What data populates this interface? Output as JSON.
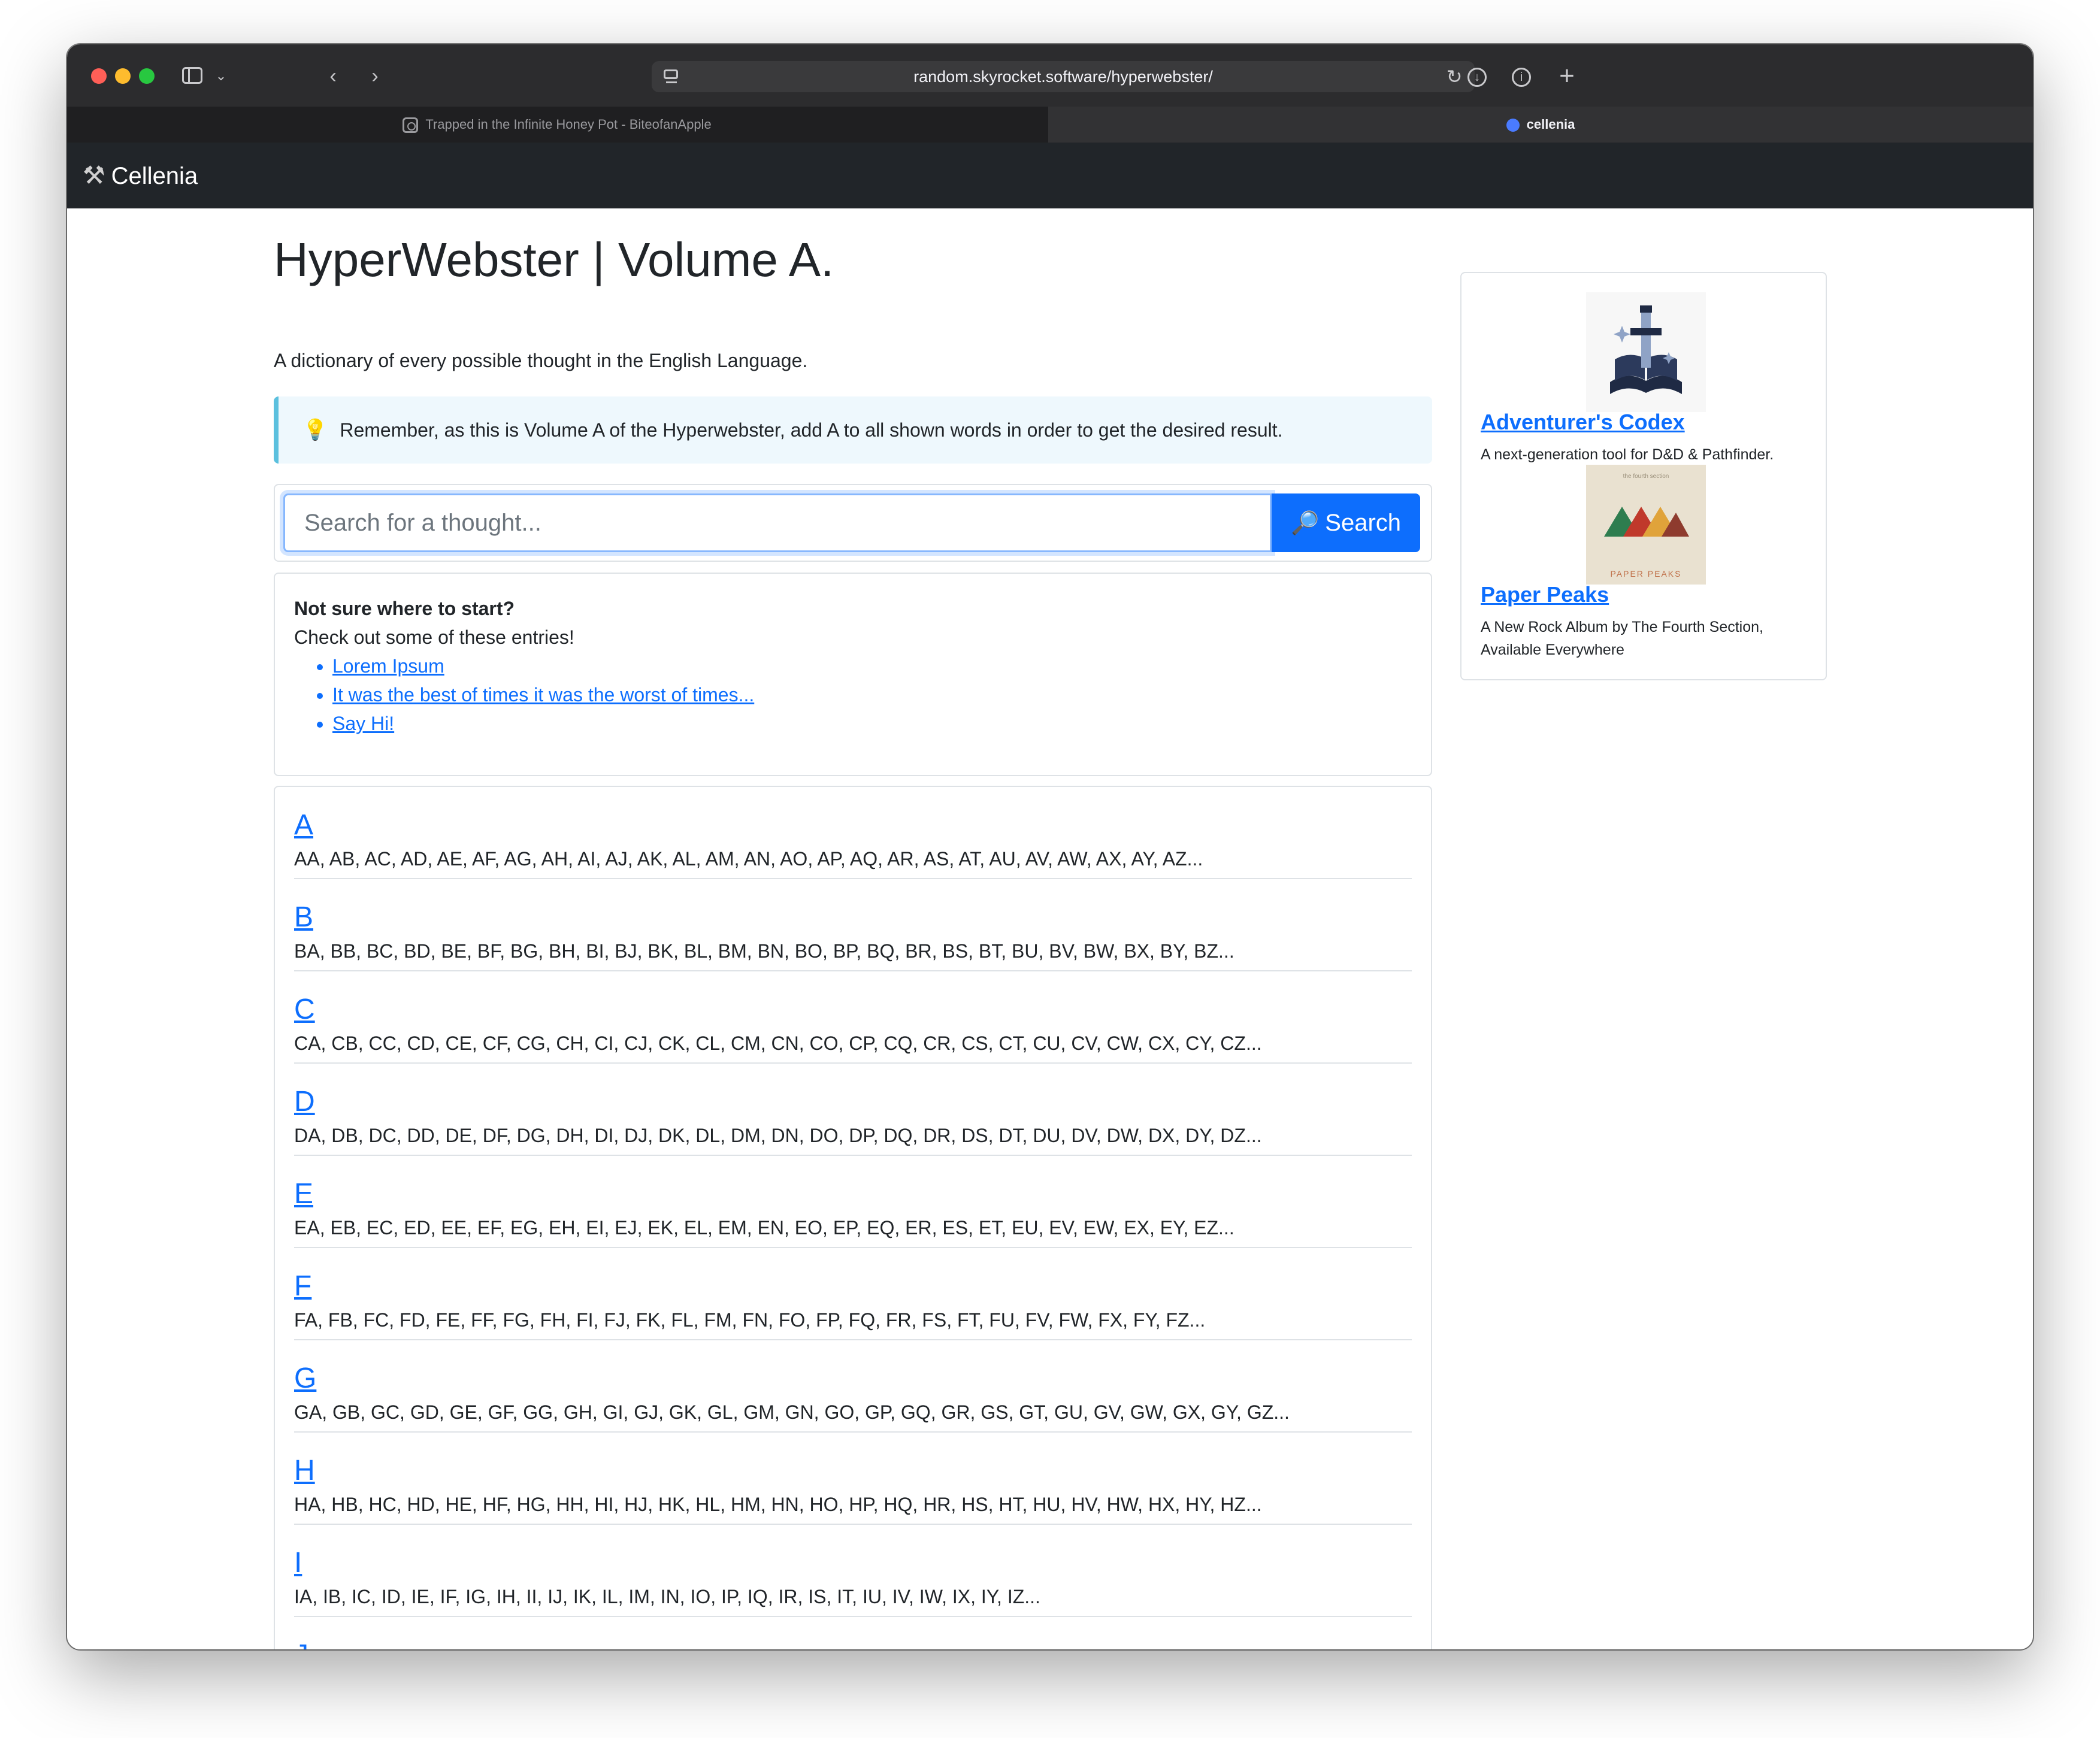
{
  "browser": {
    "url": "random.skyrocket.software/hyperwebster/",
    "tabs": [
      {
        "label": "Trapped in the Infinite Honey Pot - BiteofanApple",
        "active": false
      },
      {
        "label": "cellenia",
        "active": true
      }
    ]
  },
  "navbar": {
    "brand": "Cellenia",
    "brand_icon": "hammer-wrench-icon"
  },
  "main": {
    "title": "HyperWebster | Volume A.",
    "lead": "A dictionary of every possible thought in the English Language.",
    "callout": "Remember, as this is Volume A of the Hyperwebster, add A to all shown words in order to get the desired result.",
    "search": {
      "placeholder": "Search for a thought...",
      "button_label": "Search"
    },
    "starter": {
      "title": "Not sure where to start?",
      "subtitle": "Check out some of these entries!",
      "links": [
        "Lorem Ipsum",
        "It was the best of times it was the worst of times...",
        "Say Hi!"
      ]
    },
    "letters": [
      {
        "letter": "A",
        "combos": "AA, AB, AC, AD, AE, AF, AG, AH, AI, AJ, AK, AL, AM, AN, AO, AP, AQ, AR, AS, AT, AU, AV, AW, AX, AY, AZ..."
      },
      {
        "letter": "B",
        "combos": "BA, BB, BC, BD, BE, BF, BG, BH, BI, BJ, BK, BL, BM, BN, BO, BP, BQ, BR, BS, BT, BU, BV, BW, BX, BY, BZ..."
      },
      {
        "letter": "C",
        "combos": "CA, CB, CC, CD, CE, CF, CG, CH, CI, CJ, CK, CL, CM, CN, CO, CP, CQ, CR, CS, CT, CU, CV, CW, CX, CY, CZ..."
      },
      {
        "letter": "D",
        "combos": "DA, DB, DC, DD, DE, DF, DG, DH, DI, DJ, DK, DL, DM, DN, DO, DP, DQ, DR, DS, DT, DU, DV, DW, DX, DY, DZ..."
      },
      {
        "letter": "E",
        "combos": "EA, EB, EC, ED, EE, EF, EG, EH, EI, EJ, EK, EL, EM, EN, EO, EP, EQ, ER, ES, ET, EU, EV, EW, EX, EY, EZ..."
      },
      {
        "letter": "F",
        "combos": "FA, FB, FC, FD, FE, FF, FG, FH, FI, FJ, FK, FL, FM, FN, FO, FP, FQ, FR, FS, FT, FU, FV, FW, FX, FY, FZ..."
      },
      {
        "letter": "G",
        "combos": "GA, GB, GC, GD, GE, GF, GG, GH, GI, GJ, GK, GL, GM, GN, GO, GP, GQ, GR, GS, GT, GU, GV, GW, GX, GY, GZ..."
      },
      {
        "letter": "H",
        "combos": "HA, HB, HC, HD, HE, HF, HG, HH, HI, HJ, HK, HL, HM, HN, HO, HP, HQ, HR, HS, HT, HU, HV, HW, HX, HY, HZ..."
      },
      {
        "letter": "I",
        "combos": "IA, IB, IC, ID, IE, IF, IG, IH, II, IJ, IK, IL, IM, IN, IO, IP, IQ, IR, IS, IT, IU, IV, IW, IX, IY, IZ..."
      },
      {
        "letter": "J",
        "combos": ""
      }
    ]
  },
  "sidebar": {
    "promos": [
      {
        "title": "Adventurer's Codex",
        "description": "A next-generation tool for D&D & Pathfinder.",
        "image_icon": "sword-book-icon"
      },
      {
        "title": "Paper Peaks",
        "description": "A New Rock Album by The Fourth Section, Available Everywhere",
        "image_label": "PAPER PEAKS",
        "image_toplabel": "the fourth section"
      }
    ]
  },
  "colors": {
    "link": "#0d6efd",
    "navbar": "#212529",
    "callout_border": "#5bc0de",
    "callout_bg": "#eef8fd"
  }
}
